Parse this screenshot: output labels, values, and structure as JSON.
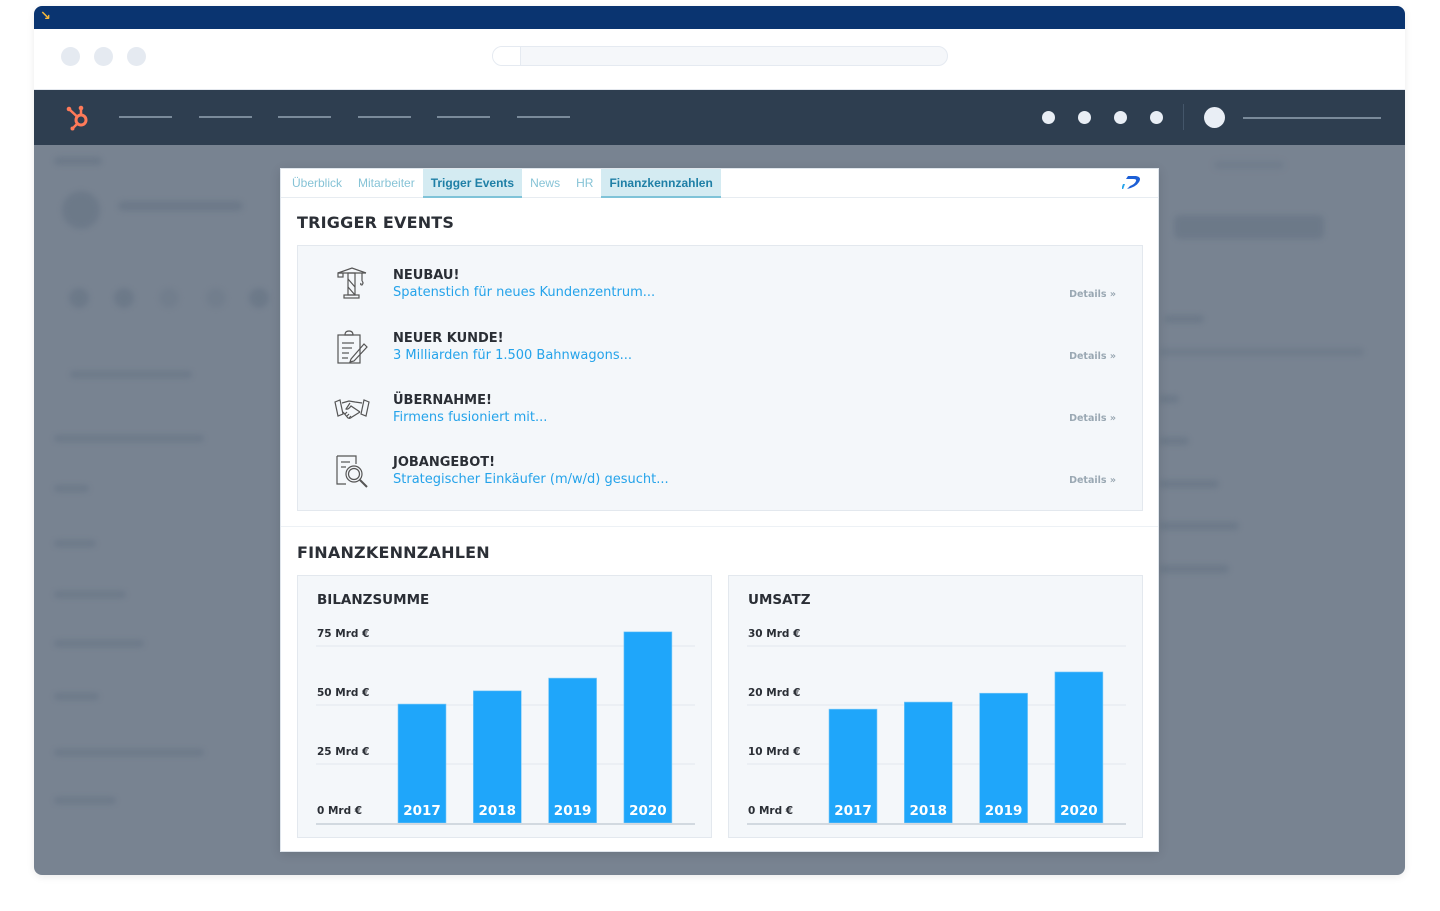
{
  "browser": {
    "corner_icon": "arrow-down-right-icon"
  },
  "app_nav": {
    "logo": "hubspot-sprocket-icon"
  },
  "panel": {
    "tabs": [
      {
        "label": "Überblick",
        "active": false
      },
      {
        "label": "Mitarbeiter",
        "active": false
      },
      {
        "label": "Trigger Events",
        "active": true
      },
      {
        "label": "News",
        "active": false
      },
      {
        "label": "HR",
        "active": false
      },
      {
        "label": "Finanzkennzahlen",
        "active": true
      }
    ],
    "brand_logo": "dealfront-d-logo-icon",
    "trigger_events": {
      "title": "TRIGGER EVENTS",
      "items": [
        {
          "icon": "crane-icon",
          "title": "NEUBAU!",
          "description": "Spatenstich für neues Kundenzentrum...",
          "details_label": "Details »"
        },
        {
          "icon": "clipboard-pen-icon",
          "title": "NEUER KUNDE!",
          "description": "3 Milliarden für 1.500 Bahnwagons...",
          "details_label": "Details »"
        },
        {
          "icon": "handshake-icon",
          "title": "ÜBERNAHME!",
          "description": "Firmens fusioniert mit...",
          "details_label": "Details »"
        },
        {
          "icon": "document-search-icon",
          "title": "JOBANGEBOT!",
          "description": "Strategischer Einkäufer (m/w/d) gesucht...",
          "details_label": "Details »"
        }
      ]
    },
    "finanzkennzahlen": {
      "title": "FINANZKENNZAHLEN"
    }
  },
  "colors": {
    "bar": "#1fa6fa",
    "link": "#25a3ea",
    "tab_active_bg": "#d4ebf2",
    "nav_bg": "#2e3e50",
    "topbar_bg": "#0a3470",
    "hubspot_orange": "#ff7a59"
  },
  "chart_data": [
    {
      "type": "bar",
      "title": "BILANZSUMME",
      "categories": [
        "2017",
        "2018",
        "2019",
        "2020"
      ],
      "values": [
        50.4,
        56,
        61.4,
        81
      ],
      "unit": "Mrd €",
      "yticks": [
        0,
        25,
        50,
        75
      ],
      "ytick_labels": [
        "0 Mrd €",
        "25 Mrd €",
        "50 Mrd €",
        "75 Mrd €"
      ],
      "ylim": [
        0,
        75
      ],
      "xlabel": "",
      "ylabel": "",
      "grid": true,
      "category_labels_inside_bars": true
    },
    {
      "type": "bar",
      "title": "UMSATZ",
      "categories": [
        "2017",
        "2018",
        "2019",
        "2020"
      ],
      "values": [
        19.3,
        20.5,
        22,
        25.6
      ],
      "unit": "Mrd €",
      "yticks": [
        0,
        10,
        20,
        30
      ],
      "ytick_labels": [
        "0 Mrd €",
        "10 Mrd €",
        "20 Mrd €",
        "30 Mrd €"
      ],
      "ylim": [
        0,
        30
      ],
      "xlabel": "",
      "ylabel": "",
      "grid": true,
      "category_labels_inside_bars": true
    }
  ]
}
